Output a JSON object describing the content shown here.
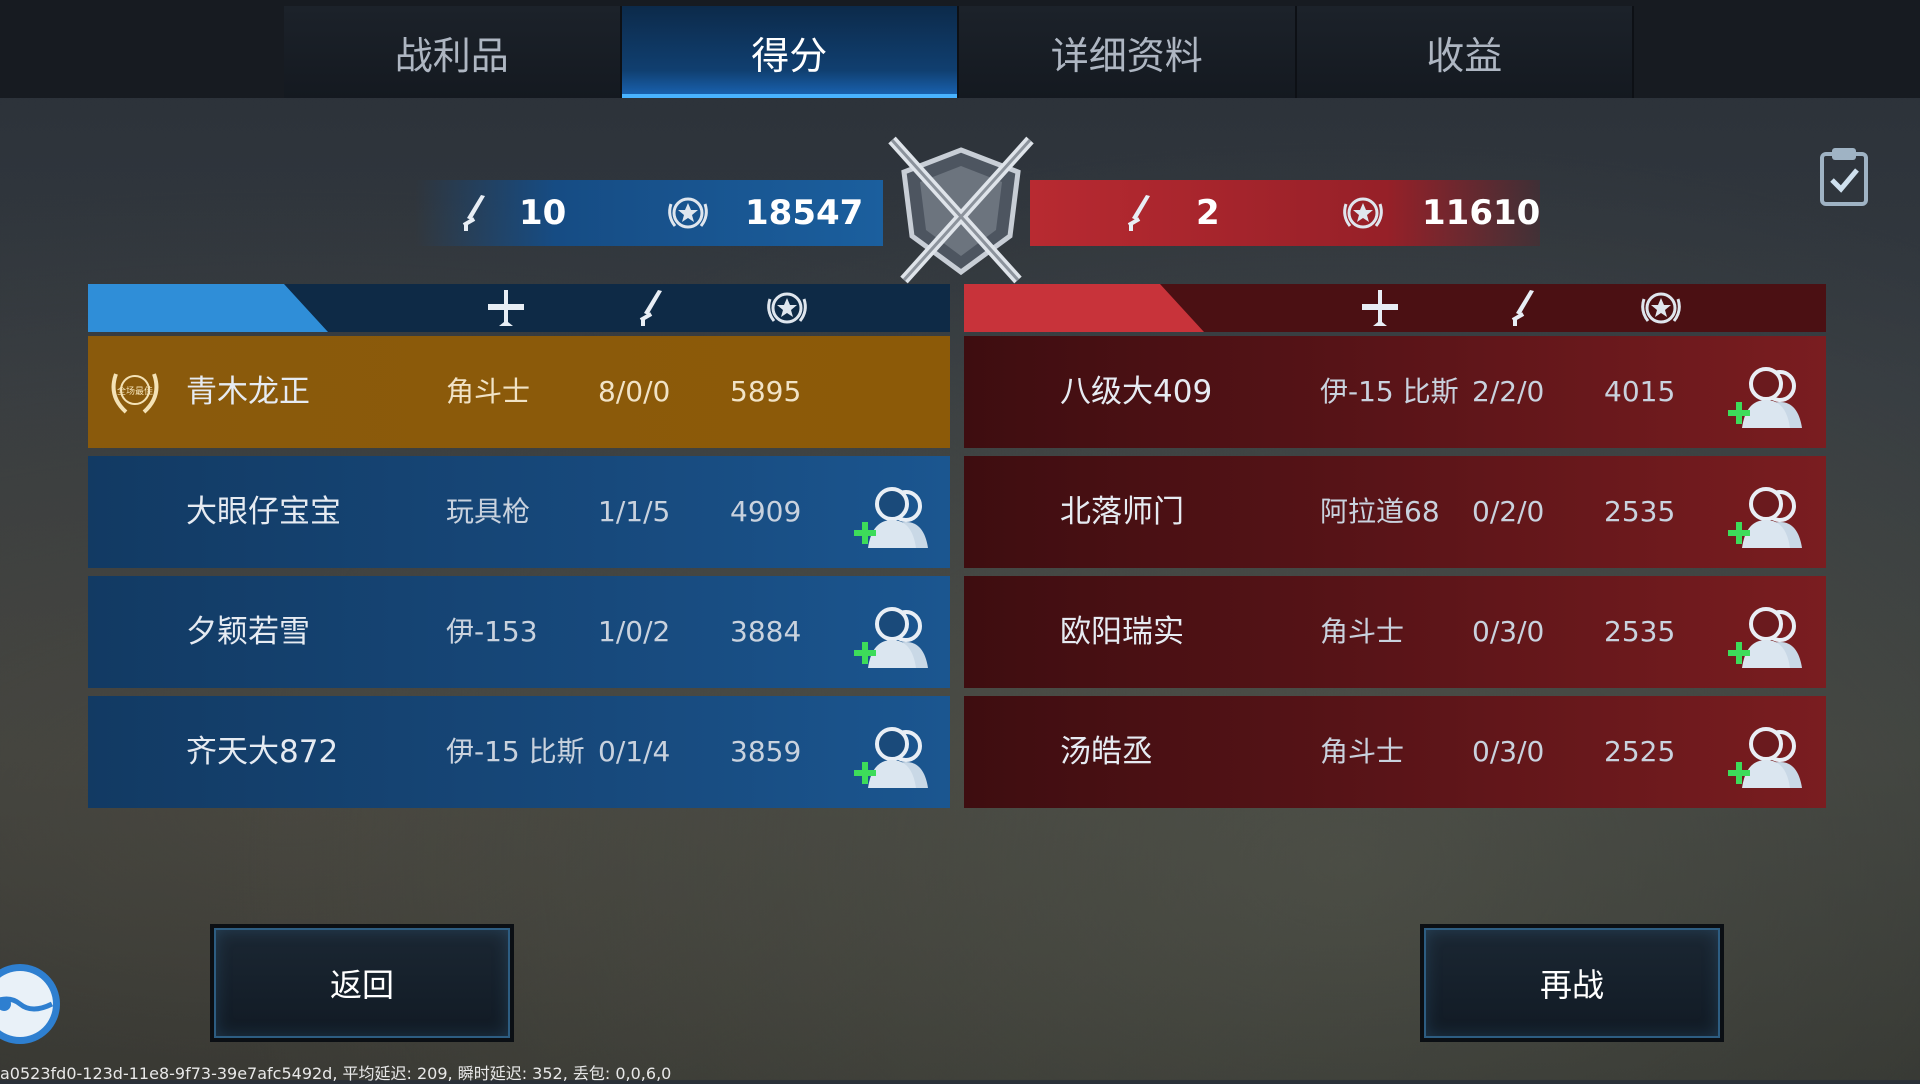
{
  "tabs": [
    "战利品",
    "得分",
    "详细资料",
    "收益"
  ],
  "active_tab": 1,
  "blue_team": {
    "kills": "10",
    "score": "18547"
  },
  "red_team": {
    "kills": "2",
    "score": "11610"
  },
  "blue_players": [
    {
      "name": "青木龙正",
      "plane": "角斗士",
      "kda": "8/0/0",
      "score": "5895",
      "best": true,
      "best_badge": "全场最佳"
    },
    {
      "name": "大眼仔宝宝",
      "plane": "玩具枪",
      "kda": "1/1/5",
      "score": "4909"
    },
    {
      "name": "夕颖若雪",
      "plane": "伊-153",
      "kda": "1/0/2",
      "score": "3884"
    },
    {
      "name": "齐天大872",
      "plane": "伊-15 比斯",
      "kda": "0/1/4",
      "score": "3859"
    }
  ],
  "red_players": [
    {
      "name": "八级大409",
      "plane": "伊-15 比斯",
      "kda": "2/2/0",
      "score": "4015"
    },
    {
      "name": "北落师门",
      "plane": "阿拉道68",
      "kda": "0/2/0",
      "score": "2535"
    },
    {
      "name": "欧阳瑞实",
      "plane": "角斗士",
      "kda": "0/3/0",
      "score": "2535"
    },
    {
      "name": "汤皓丞",
      "plane": "角斗士",
      "kda": "0/3/0",
      "score": "2525"
    }
  ],
  "buttons": {
    "back": "返回",
    "again": "再战"
  },
  "footer": "a0523fd0-123d-11e8-9f73-39e7afc5492d, 平均延迟: 209, 瞬时延迟: 352, 丢包: 0,0,6,0",
  "colors": {
    "blue_accent": "#2f8ed8",
    "red_accent": "#c8333a",
    "best_gold": "#8a5a0c"
  }
}
